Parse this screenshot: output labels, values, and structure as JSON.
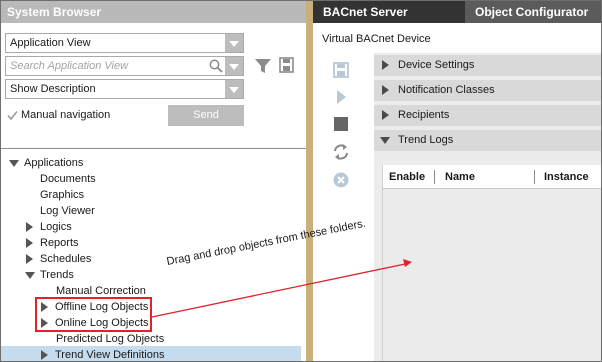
{
  "left_panel": {
    "title": "System Browser",
    "view_select": {
      "value": "Application View"
    },
    "search": {
      "placeholder": "Search Application View"
    },
    "description_select": {
      "value": "Show Description"
    },
    "manual_navigation": {
      "label": "Manual navigation",
      "checked": true
    },
    "send_label": "Send"
  },
  "tree": {
    "applications": "Applications",
    "documents": "Documents",
    "graphics": "Graphics",
    "log_viewer": "Log Viewer",
    "logics": "Logics",
    "reports": "Reports",
    "schedules": "Schedules",
    "trends": "Trends",
    "manual_correction": "Manual Correction",
    "offline_log_objects": "Offline Log Objects",
    "online_log_objects": "Online Log Objects",
    "predicted_log_objects": "Predicted Log Objects",
    "trend_view_definitions": "Trend View Definitions"
  },
  "annotation": "Drag and drop objects from these folders.",
  "right_panel": {
    "tabs": [
      "BACnet Server",
      "Object Configurator"
    ],
    "active_tab": "Object Configurator",
    "device_title": "Virtual BACnet Device",
    "sections": [
      "Device Settings",
      "Notification Classes",
      "Recipients",
      "Trend Logs"
    ],
    "trend_table_columns": [
      "Enable",
      "Name",
      "Instance"
    ],
    "toolbar_icons": [
      "save-icon",
      "play-icon",
      "stop-icon",
      "refresh-icon",
      "cancel-icon"
    ]
  },
  "colors": {
    "header_gray": "#b9b9b9",
    "tab_dark": "#333333",
    "divider": "#c8b07a",
    "callout_red": "#e0232a",
    "selection": "#c5dcef"
  }
}
